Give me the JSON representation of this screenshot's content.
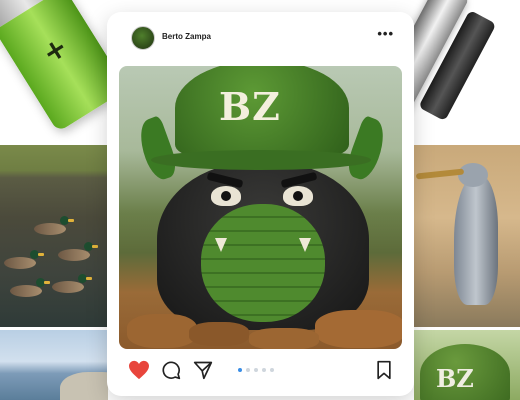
{
  "post": {
    "username": "Berto Zampa",
    "more_icon": "more-horizontal-icon",
    "image_text": "BZ",
    "carousel": {
      "count": 5,
      "active": 0
    }
  },
  "actions": {
    "like_icon": "heart-icon",
    "like_color": "#e8453c",
    "comment_icon": "comment-icon",
    "share_icon": "send-icon",
    "save_icon": "bookmark-icon"
  },
  "background_photos": {
    "small_cap_text": "BZ"
  },
  "colors": {
    "accent": "#3a8ee6",
    "card_bg": "#ffffff"
  }
}
